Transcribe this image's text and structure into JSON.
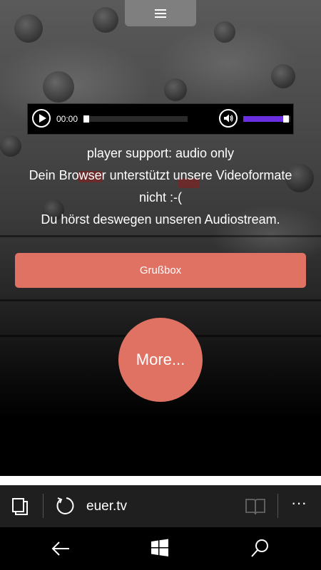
{
  "player": {
    "current_time": "00:00",
    "progress": 0.03,
    "volume": 0.85,
    "volume_color": "#6a2fe0"
  },
  "messages": {
    "line1": "player support: audio only",
    "line2": "Dein Browser unterstützt unsere Videoformate",
    "line3": "nicht :-(",
    "line4": "Du hörst deswegen unseren Audiostream."
  },
  "buttons": {
    "grussbox": "Grußbox",
    "more": "More...",
    "accent_color": "#e07264"
  },
  "browser": {
    "url": "euer.tv",
    "more_menu": "···"
  },
  "icons": {
    "menu": "hamburger-icon",
    "play": "play-icon",
    "volume": "speaker-icon",
    "tabs": "tabs-icon",
    "refresh": "refresh-icon",
    "reading_view": "book-icon",
    "back": "back-arrow-icon",
    "start": "windows-logo-icon",
    "search": "search-icon"
  }
}
